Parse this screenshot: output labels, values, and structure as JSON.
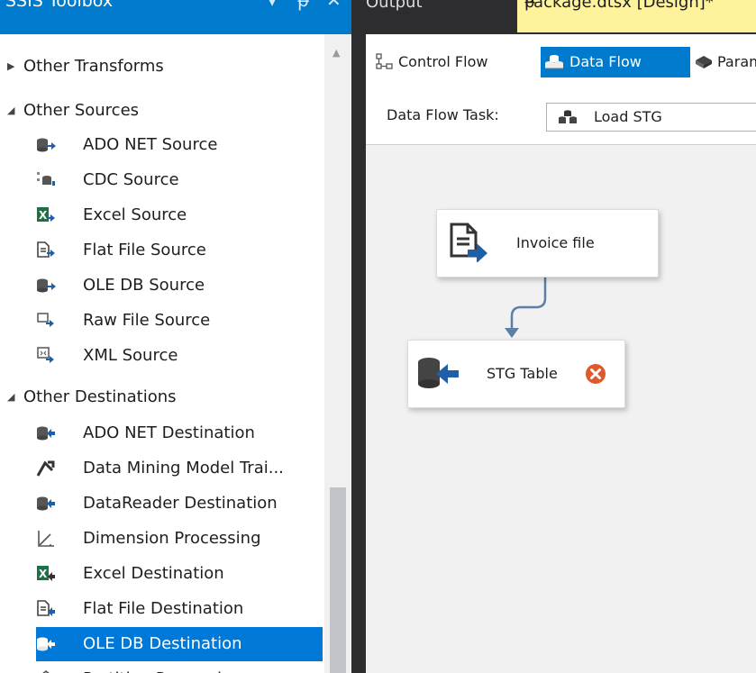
{
  "toolbox": {
    "title": "SSIS Toolbox",
    "header_buttons": {
      "dropdown": "▾",
      "pin": "ᵽ",
      "close": "✕"
    },
    "groups": [
      {
        "label": "Other Transforms",
        "expanded": false
      },
      {
        "label": "Other Sources",
        "expanded": true,
        "items": [
          {
            "label": "ADO NET Source",
            "icon": "ado-net-source-icon"
          },
          {
            "label": "CDC Source",
            "icon": "cdc-source-icon"
          },
          {
            "label": "Excel Source",
            "icon": "excel-source-icon"
          },
          {
            "label": "Flat File Source",
            "icon": "flat-file-source-icon"
          },
          {
            "label": "OLE DB Source",
            "icon": "ole-db-source-icon"
          },
          {
            "label": "Raw File Source",
            "icon": "raw-file-source-icon"
          },
          {
            "label": "XML Source",
            "icon": "xml-source-icon"
          }
        ]
      },
      {
        "label": "Other Destinations",
        "expanded": true,
        "items": [
          {
            "label": "ADO NET Destination",
            "icon": "ado-net-destination-icon"
          },
          {
            "label": "Data Mining Model Trai...",
            "icon": "data-mining-icon"
          },
          {
            "label": "DataReader Destination",
            "icon": "datareader-destination-icon"
          },
          {
            "label": "Dimension Processing",
            "icon": "dimension-processing-icon"
          },
          {
            "label": "Excel Destination",
            "icon": "excel-destination-icon"
          },
          {
            "label": "Flat File Destination",
            "icon": "flat-file-destination-icon"
          },
          {
            "label": "OLE DB Destination",
            "icon": "ole-db-destination-icon",
            "selected": true
          },
          {
            "label": "Partition Processing",
            "icon": "partition-processing-icon"
          }
        ]
      }
    ]
  },
  "tabs": {
    "output": "Output",
    "package": "Package.dtsx [Design]*",
    "pin": "ᵽ"
  },
  "designer": {
    "subtabs": {
      "control_flow": "Control Flow",
      "data_flow": "Data Flow",
      "parameters": "Parameters"
    },
    "task_label": "Data Flow Task:",
    "task_value": "Load STG"
  },
  "components": {
    "invoice": {
      "label": "Invoice file",
      "icon": "flat-file-source-icon"
    },
    "stg": {
      "label": "STG Table",
      "icon": "ole-db-destination-icon",
      "status": "error"
    }
  },
  "colors": {
    "accent": "#007acc",
    "selected": "#0078d7",
    "error": "#e0592a",
    "tab_active": "#fff29d",
    "path": "#5b7fa6"
  }
}
